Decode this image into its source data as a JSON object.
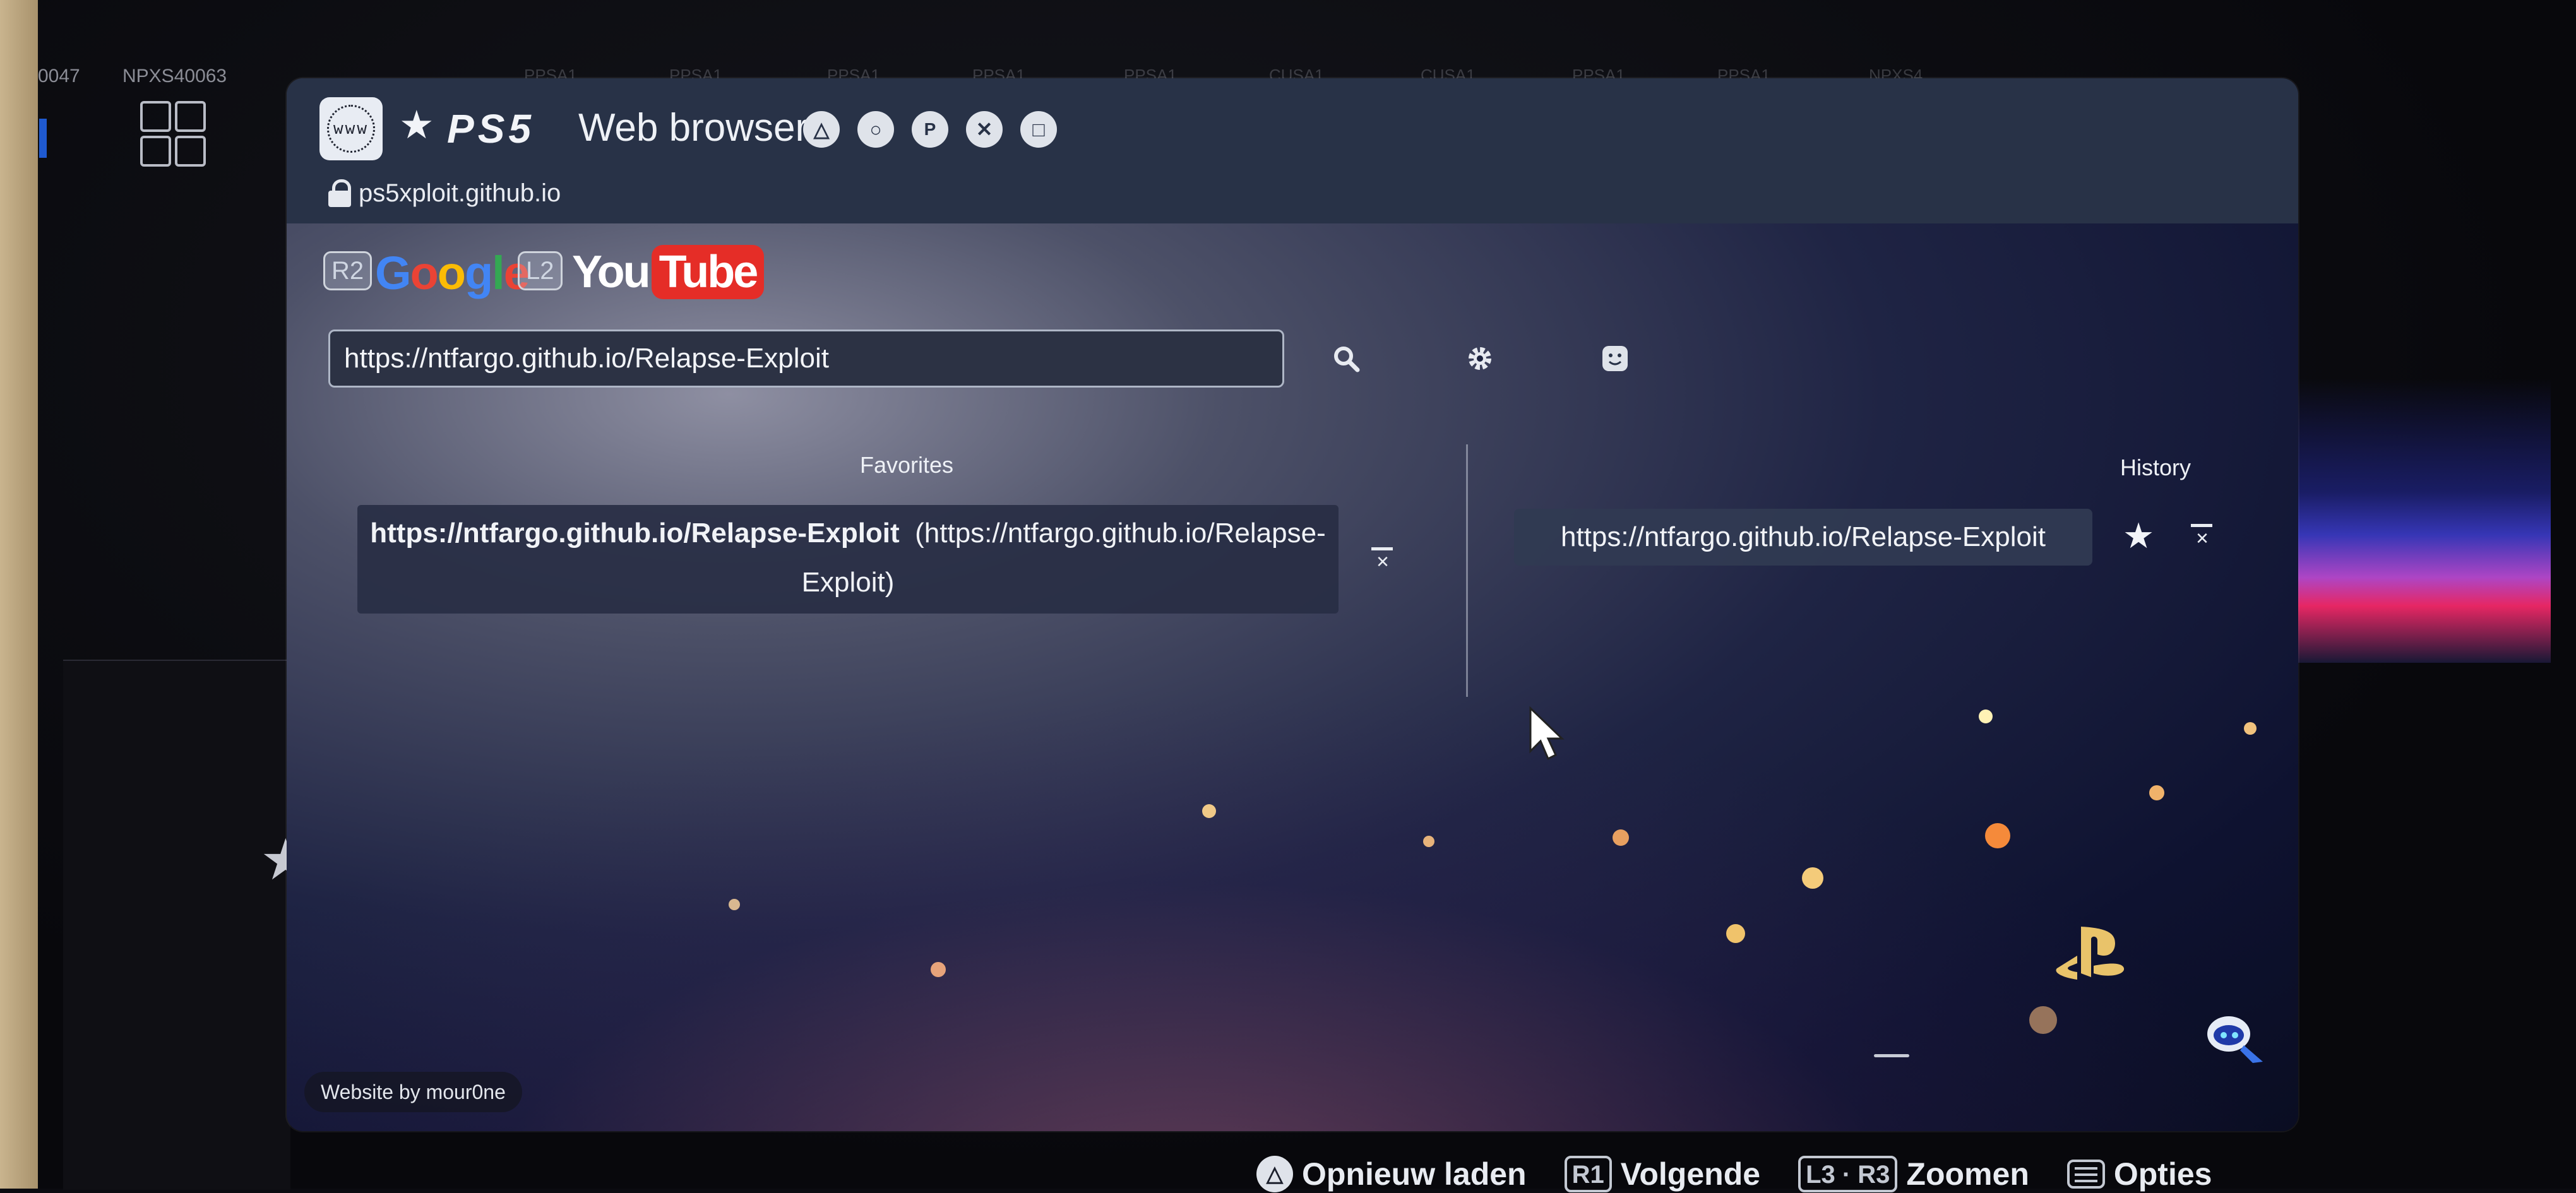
{
  "home_strip": {
    "left_labels": [
      "0047",
      "NPXS40063"
    ],
    "tile_labels": [
      "PPSA1...",
      "PPSA1...",
      "PPSA1...",
      "PPSA1...",
      "PPSA1...",
      "CUSA1...",
      "CUSA1...",
      "PPSA1...",
      "PPSA1...",
      "NPXS4..."
    ]
  },
  "window": {
    "app_icon_text": "www",
    "title_star": "★",
    "title_brand": "PS5",
    "title": "Web browser",
    "title_shapes": [
      "triangle-icon",
      "circle-icon",
      "playstation-icon",
      "cross-icon",
      "square-icon"
    ],
    "site_url": "ps5xploit.github.io"
  },
  "shortcuts": {
    "google_key": "R2",
    "youtube_key": "L2",
    "youtube_you": "You",
    "youtube_tube": "Tube"
  },
  "search": {
    "value": "https://ntfargo.github.io/Relapse-Exploit"
  },
  "favorites": {
    "title": "Favorites",
    "items": [
      {
        "name": "https://ntfargo.github.io/Relapse-Exploit",
        "url_line1": "(https://ntfargo.github.io/Relapse-",
        "url_line2": "Exploit)"
      }
    ]
  },
  "history": {
    "title": "History",
    "items": [
      {
        "url": "https://ntfargo.github.io/Relapse-Exploit"
      }
    ]
  },
  "footer": {
    "credit": "Website by mour0ne"
  },
  "hints": [
    {
      "key": "△",
      "label": "Opnieuw laden"
    },
    {
      "key": "R1",
      "label": "Volgende"
    },
    {
      "key": "L3 · R3",
      "label": "Zoomen"
    },
    {
      "key": "menu",
      "label": "Opties"
    }
  ],
  "colors": {
    "titlebar": "#283247",
    "youtube_red": "#e52d27",
    "google_blue": "#4285f4",
    "google_red": "#ea4335",
    "google_yellow": "#fbbc05",
    "google_green": "#34a853"
  }
}
